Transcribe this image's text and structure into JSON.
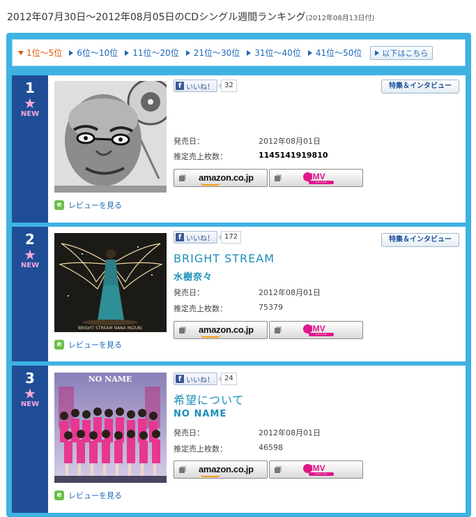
{
  "header": {
    "title": "2012年07月30日～2012年08月05日のCDシングル週間ランキング",
    "date_note": "(2012年08月13日付)"
  },
  "tabs": [
    {
      "label": "1位～5位",
      "active": true
    },
    {
      "label": "6位～10位",
      "active": false
    },
    {
      "label": "11位～20位",
      "active": false
    },
    {
      "label": "21位～30位",
      "active": false
    },
    {
      "label": "31位～40位",
      "active": false
    },
    {
      "label": "41位～50位",
      "active": false
    }
  ],
  "more_label": "以下はこちら",
  "labels": {
    "like": "いいね！",
    "feature": "特集＆インタビュー",
    "release_date": "発売日：",
    "estimated_sales": "推定売上枚数：",
    "review": "レビューを見る",
    "amazon": "amazon.co.jp",
    "hmv": "HMV",
    "hmv_sub": "ONLINE",
    "new": "NEW",
    "fb": "f",
    "review_icon": "e",
    "star": "★"
  },
  "colors": {
    "frame": "#3fb2e3",
    "rank_column": "#1f4e96",
    "new_badge": "#f4a8dc",
    "title_text": "#1b8fb9",
    "active_tab": "#e35400",
    "link": "#1a67b8"
  },
  "rankings": [
    {
      "rank": "1",
      "badge": "NEW",
      "likes": "32",
      "title": "",
      "artist": "",
      "release_date": "2012年08月01日",
      "estimated_sales": "1145141919810",
      "has_feature": true,
      "cover_icon": "bald-man-with-turntable-photo"
    },
    {
      "rank": "2",
      "badge": "NEW",
      "likes": "172",
      "title": "BRIGHT STREAM",
      "artist": "水樹奈々",
      "release_date": "2012年08月01日",
      "estimated_sales": "75379",
      "has_feature": true,
      "cover_icon": "woman-with-light-wings-photo"
    },
    {
      "rank": "3",
      "badge": "NEW",
      "likes": "24",
      "title": "希望について",
      "artist": "NO NAME",
      "release_date": "2012年08月01日",
      "estimated_sales": "46598",
      "has_feature": false,
      "cover_icon": "idol-group-photo"
    }
  ]
}
